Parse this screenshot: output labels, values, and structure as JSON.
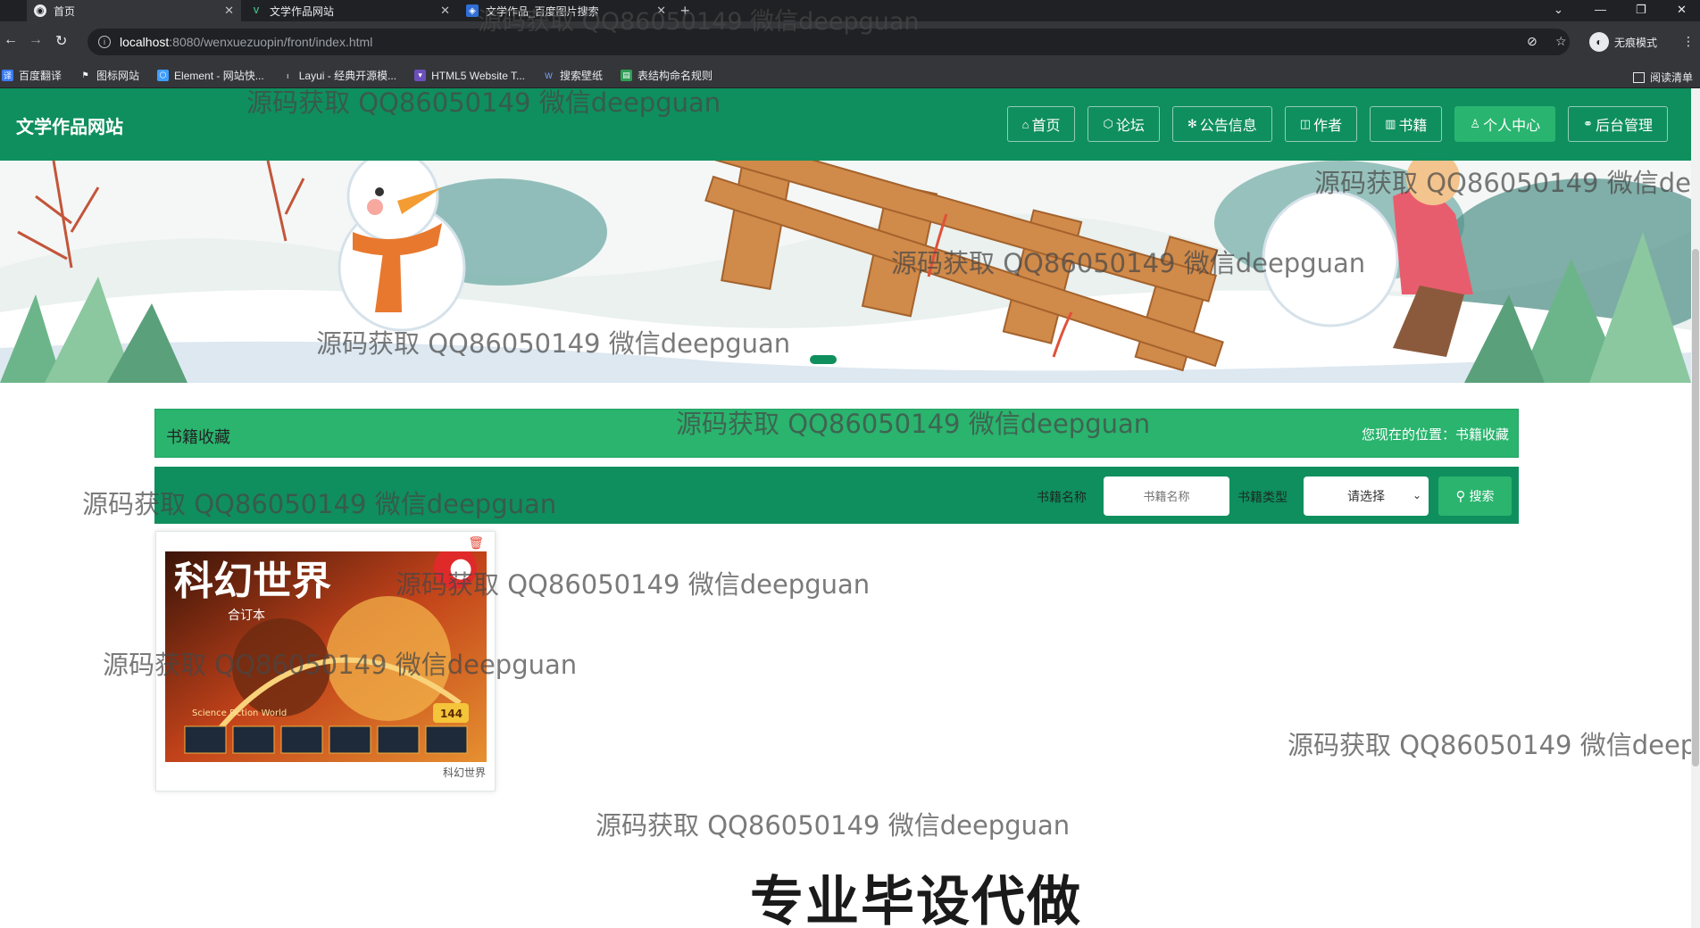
{
  "browser": {
    "tabs": [
      {
        "title": "首页",
        "active": true
      },
      {
        "title": "文学作品网站",
        "active": false
      },
      {
        "title": "文学作品_百度图片搜索",
        "active": false
      }
    ],
    "url_host": "localhost",
    "url_path": ":8080/wenxuezuopin/front/index.html",
    "incognito_label": "无痕模式",
    "bookmarks": [
      "百度翻译",
      "图标网站",
      "Element - 网站快...",
      "Layui - 经典开源模...",
      "HTML5 Website T...",
      "搜索壁纸",
      "表结构命名规则"
    ],
    "reading_list": "阅读清单"
  },
  "header": {
    "site_title": "文学作品网站",
    "nav": [
      {
        "label": "首页",
        "icon": "home-icon",
        "glyph": "⌂",
        "active": false
      },
      {
        "label": "论坛",
        "icon": "forum-icon",
        "glyph": "⬡",
        "active": false
      },
      {
        "label": "公告信息",
        "icon": "announcement-icon",
        "glyph": "✻",
        "active": false
      },
      {
        "label": "作者",
        "icon": "author-icon",
        "glyph": "◫",
        "active": false
      },
      {
        "label": "书籍",
        "icon": "book-icon",
        "glyph": "▥",
        "active": false
      },
      {
        "label": "个人中心",
        "icon": "user-icon",
        "glyph": "♙",
        "active": true
      },
      {
        "label": "后台管理",
        "icon": "link-icon",
        "glyph": "⚭",
        "active": false
      }
    ],
    "colors": {
      "primary": "#0f8f5e",
      "accent": "#2ab46e"
    }
  },
  "banner": {
    "slides": 2,
    "active_slide": 1
  },
  "section": {
    "title": "书籍收藏",
    "breadcrumb": "您现在的位置：书籍收藏"
  },
  "search": {
    "name_label": "书籍名称",
    "name_placeholder": "书籍名称",
    "type_label": "书籍类型",
    "type_selected": "请选择",
    "button_label": "搜索"
  },
  "books": [
    {
      "cover_title": "科幻世界",
      "cover_subtitle": "合订本",
      "cover_en": "Science Fiction World",
      "cover_issue": "144",
      "caption": "科幻世界"
    }
  ],
  "watermark": {
    "text": "源码获取 QQ86050149 微信deepguan",
    "promo": "专业毕设代做"
  }
}
